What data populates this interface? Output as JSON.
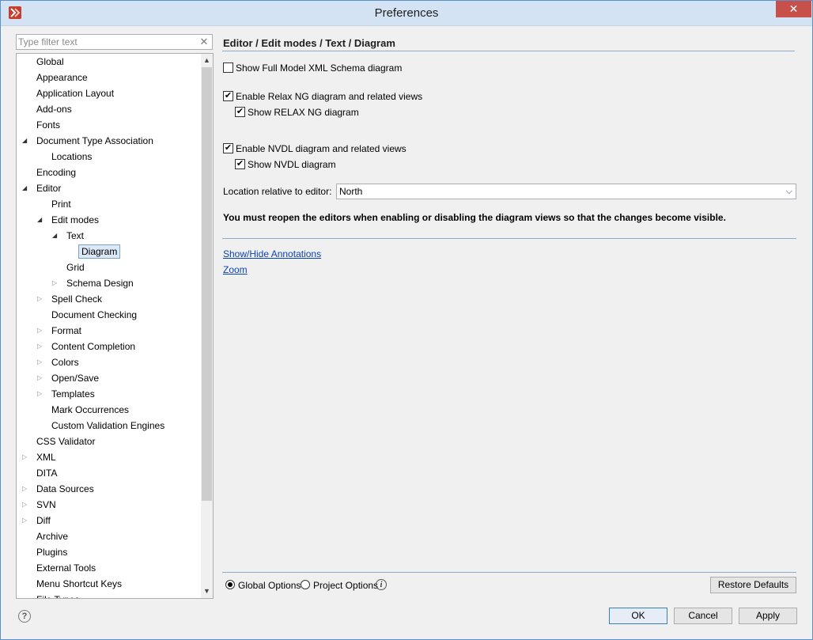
{
  "window": {
    "title": "Preferences"
  },
  "filter": {
    "placeholder": "Type filter text"
  },
  "tree": {
    "items": [
      {
        "label": "Global",
        "expander": ""
      },
      {
        "label": "Appearance",
        "expander": ""
      },
      {
        "label": "Application Layout",
        "expander": ""
      },
      {
        "label": "Add-ons",
        "expander": ""
      },
      {
        "label": "Fonts",
        "expander": ""
      },
      {
        "label": "Document Type Association",
        "expander": "open"
      },
      {
        "label": "Locations",
        "expander": ""
      },
      {
        "label": "Encoding",
        "expander": ""
      },
      {
        "label": "Editor",
        "expander": "open"
      },
      {
        "label": "Print",
        "expander": ""
      },
      {
        "label": "Edit modes",
        "expander": "open"
      },
      {
        "label": "Text",
        "expander": "open"
      },
      {
        "label": "Diagram",
        "expander": "",
        "selected": true
      },
      {
        "label": "Grid",
        "expander": ""
      },
      {
        "label": "Schema Design",
        "expander": "closed"
      },
      {
        "label": "Spell Check",
        "expander": "closed"
      },
      {
        "label": "Document Checking",
        "expander": ""
      },
      {
        "label": "Format",
        "expander": "closed"
      },
      {
        "label": "Content Completion",
        "expander": "closed"
      },
      {
        "label": "Colors",
        "expander": "closed"
      },
      {
        "label": "Open/Save",
        "expander": "closed"
      },
      {
        "label": "Templates",
        "expander": "closed"
      },
      {
        "label": "Mark Occurrences",
        "expander": ""
      },
      {
        "label": "Custom Validation Engines",
        "expander": ""
      },
      {
        "label": "CSS Validator",
        "expander": ""
      },
      {
        "label": "XML",
        "expander": "closed"
      },
      {
        "label": "DITA",
        "expander": ""
      },
      {
        "label": "Data Sources",
        "expander": "closed"
      },
      {
        "label": "SVN",
        "expander": "closed"
      },
      {
        "label": "Diff",
        "expander": "closed"
      },
      {
        "label": "Archive",
        "expander": ""
      },
      {
        "label": "Plugins",
        "expander": ""
      },
      {
        "label": "External Tools",
        "expander": ""
      },
      {
        "label": "Menu Shortcut Keys",
        "expander": ""
      },
      {
        "label": "File Types",
        "expander": ""
      }
    ]
  },
  "panel": {
    "breadcrumb": "Editor / Edit modes / Text / Diagram",
    "options": [
      {
        "label": "Show Full Model XML Schema diagram",
        "checked": false
      },
      {
        "label": "Enable Relax NG diagram and related views",
        "checked": true
      },
      {
        "label": "Show RELAX NG diagram",
        "checked": true
      },
      {
        "label": "Enable NVDL diagram and related views",
        "checked": true
      },
      {
        "label": "Show NVDL diagram",
        "checked": true
      }
    ],
    "location": {
      "label": "Location relative to editor:",
      "value": "North"
    },
    "note": "You must reopen the editors when enabling or disabling the diagram views so that the changes become visible.",
    "links": {
      "annotations": "Show/Hide Annotations",
      "zoom": "Zoom"
    }
  },
  "scope": {
    "global_label": "Global Options",
    "project_label": "Project Options",
    "selected": "global"
  },
  "buttons": {
    "restore": "Restore Defaults",
    "ok": "OK",
    "cancel": "Cancel",
    "apply": "Apply"
  }
}
